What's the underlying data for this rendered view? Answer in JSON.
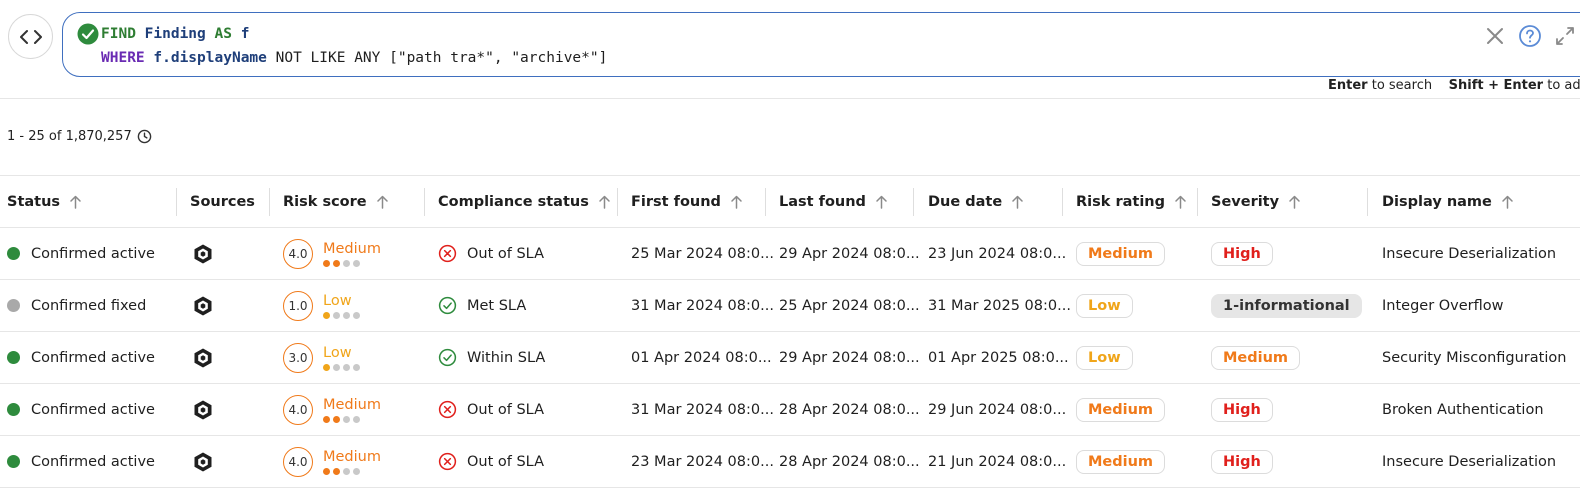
{
  "query": {
    "line1": {
      "kw1": "FIND",
      "entity": "Finding",
      "kw2": "AS",
      "alias": "f"
    },
    "line2": {
      "kw": "WHERE",
      "field": "f.displayName",
      "rest": " NOT LIKE ANY [\"path tra*\", \"archive*\"]"
    }
  },
  "hint": {
    "enter_key": "Enter",
    "enter_text": "to search",
    "shift_key": "Shift + Enter",
    "shift_text": "to ad"
  },
  "results": {
    "count_text": "1 - 25 of 1,870,257"
  },
  "columns": [
    "Status",
    "Sources",
    "Risk score",
    "Compliance status",
    "First found",
    "Last found",
    "Due date",
    "Risk rating",
    "Severity",
    "Display name"
  ],
  "rows": [
    {
      "status": "Confirmed active",
      "status_color": "#2e8b3d",
      "score": "4.0",
      "score_label": "Medium",
      "score_level": 2,
      "score_color": "#f07a1a",
      "compliance": "Out of SLA",
      "compliance_kind": "bad",
      "first_found": "25 Mar 2024 08:0...",
      "last_found": "29 Apr 2024 08:0...",
      "due_date": "23 Jun 2024 08:0...",
      "risk_rating": "Medium",
      "risk_rating_color": "#f07a1a",
      "severity": "High",
      "severity_color": "#e0201c",
      "severity_style": "pill",
      "display_name": "Insecure Deserialization"
    },
    {
      "status": "Confirmed fixed",
      "status_color": "#a9a9a9",
      "score": "1.0",
      "score_label": "Low",
      "score_level": 1,
      "score_color": "#f0a51a",
      "compliance": "Met SLA",
      "compliance_kind": "good",
      "first_found": "31 Mar 2024 08:0...",
      "last_found": "25 Apr 2024 08:0...",
      "due_date": "31 Mar 2025 08:0...",
      "risk_rating": "Low",
      "risk_rating_color": "#f0a51a",
      "severity": "1-informational",
      "severity_color": "#333333",
      "severity_style": "gray",
      "display_name": "Integer Overflow"
    },
    {
      "status": "Confirmed active",
      "status_color": "#2e8b3d",
      "score": "3.0",
      "score_label": "Low",
      "score_level": 1,
      "score_color": "#f0a51a",
      "compliance": "Within SLA",
      "compliance_kind": "good",
      "first_found": "01 Apr 2024 08:0...",
      "last_found": "29 Apr 2024 08:0...",
      "due_date": "01 Apr 2025 08:0...",
      "risk_rating": "Low",
      "risk_rating_color": "#f0a51a",
      "severity": "Medium",
      "severity_color": "#f07a1a",
      "severity_style": "pill",
      "display_name": "Security Misconfiguration"
    },
    {
      "status": "Confirmed active",
      "status_color": "#2e8b3d",
      "score": "4.0",
      "score_label": "Medium",
      "score_level": 2,
      "score_color": "#f07a1a",
      "compliance": "Out of SLA",
      "compliance_kind": "bad",
      "first_found": "31 Mar 2024 08:0...",
      "last_found": "28 Apr 2024 08:0...",
      "due_date": "29 Jun 2024 08:0...",
      "risk_rating": "Medium",
      "risk_rating_color": "#f07a1a",
      "severity": "High",
      "severity_color": "#e0201c",
      "severity_style": "pill",
      "display_name": "Broken Authentication"
    },
    {
      "status": "Confirmed active",
      "status_color": "#2e8b3d",
      "score": "4.0",
      "score_label": "Medium",
      "score_level": 2,
      "score_color": "#f07a1a",
      "compliance": "Out of SLA",
      "compliance_kind": "bad",
      "first_found": "23 Mar 2024 08:0...",
      "last_found": "28 Apr 2024 08:0...",
      "due_date": "21 Jun 2024 08:0...",
      "risk_rating": "Medium",
      "risk_rating_color": "#f07a1a",
      "severity": "High",
      "severity_color": "#e0201c",
      "severity_style": "pill",
      "display_name": "Insecure Deserialization"
    }
  ],
  "colors": {
    "accent": "#3f6fbf",
    "query_keyword": "#2e7d32",
    "query_where": "#6a2bb3",
    "compliance_bad": "#e0201c",
    "compliance_good": "#2e8b3d"
  },
  "icons": {
    "mode_toggle": "code-brackets-icon",
    "query_valid": "check-circle-icon",
    "clear": "close-icon",
    "help": "help-circle-icon",
    "expand": "expand-icon",
    "history": "clock-icon",
    "source": "hexagon-logo-icon"
  }
}
